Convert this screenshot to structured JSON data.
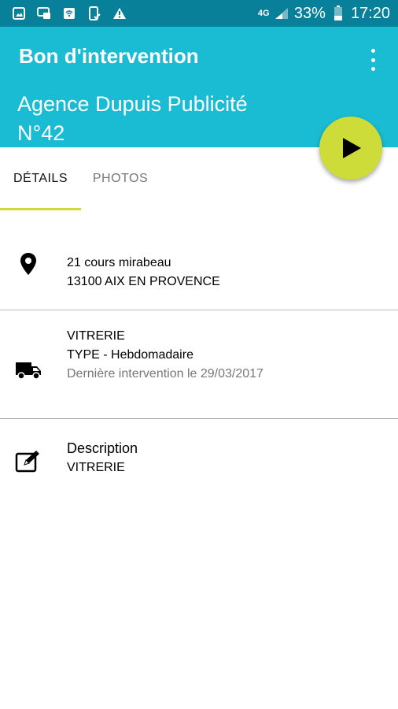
{
  "status_bar": {
    "network_label": "4G",
    "battery_percent": "33%",
    "time": "17:20",
    "notification_icons": [
      "gallery-icon",
      "sms-icon",
      "wifi-box-icon",
      "phone-check-icon",
      "warning-icon"
    ]
  },
  "header": {
    "title": "Bon d'intervention",
    "client_name": "Agence Dupuis Publicité",
    "order_number": "N°42"
  },
  "tabs": [
    {
      "label": "DÉTAILS",
      "active": true
    },
    {
      "label": "PHOTOS",
      "active": false
    }
  ],
  "address": {
    "line1": "21  cours mirabeau",
    "line2": "13100 AIX EN PROVENCE"
  },
  "service": {
    "name": "VITRERIE",
    "type": "TYPE - Hebdomadaire",
    "last_intervention": "Dernière intervention le 29/03/2017"
  },
  "description": {
    "label": "Description",
    "value": "VITRERIE"
  },
  "colors": {
    "status_bar": "#08809a",
    "header": "#19bcd3",
    "accent": "#cddc39"
  }
}
